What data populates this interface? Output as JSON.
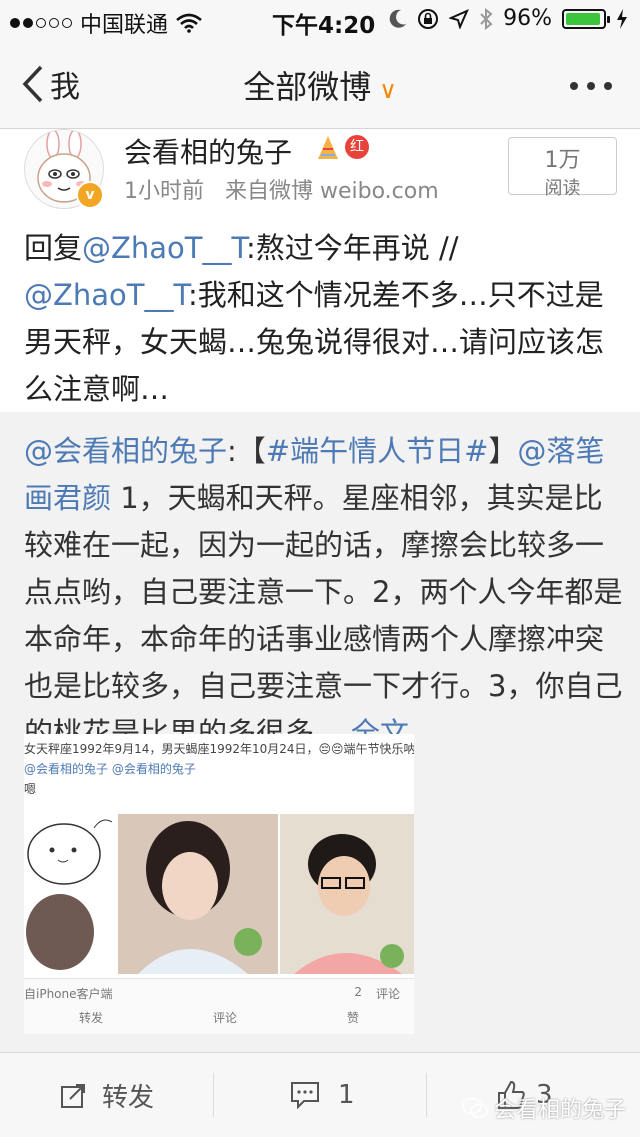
{
  "status": {
    "carrier": "中国联通",
    "time": "下午4:20",
    "battery": "96%",
    "signal_bars_filled": 2,
    "signal_bars_total": 5
  },
  "nav": {
    "back_label": "我",
    "title": "全部微博",
    "title_chevron": "∨"
  },
  "post": {
    "username": "会看相的兔子",
    "verified_badge": "v",
    "red_badge": "红",
    "time": "1小时前",
    "source": "来自微博 weibo.com",
    "reads_count": "1万",
    "reads_label": "阅读",
    "content": {
      "p1": "回复",
      "m1": "@ZhaoT__T",
      "p2": ":熬过今年再说 //",
      "m2": "@ZhaoT__T",
      "p3": ":我和这个情况差不多…只不过是男天秤，女天蝎…兔兔说得很对…请问应该怎么注意啊…"
    }
  },
  "repost": {
    "m1": "@会看相的兔子",
    "t1": ":【",
    "m2": "#端午情人节日#",
    "t2": "】",
    "m3": "@落笔画君颜",
    "t3": " 1，天蝎和天秤。星座相邻，其实是比较难在一起，因为一起的话，摩擦会比较多一点点哟，自己要注意一下。2，两个人今年都是本命年，本命年的话事业感情两个人摩擦冲突也是比较多，自己要注意一下才行。3，你自己的桃花是比男的多很多... ",
    "full_label": "全文",
    "image": {
      "caption": "女天秤座1992年9月14，男天蝎座1992年10月24日，😔😔端午节快乐呐",
      "caption2": "@会看相的兔子 @会看相的兔子",
      "caption3": "嗯",
      "source": "自iPhone客户端",
      "repost_count": "2",
      "comment_label": "评论",
      "bar_repost": "转发",
      "bar_comment": "评论",
      "bar_like": "赞"
    }
  },
  "toolbar": {
    "repost_label": "转发",
    "comment_count": "1",
    "like_count": "3"
  },
  "watermark": "会看相的兔子"
}
